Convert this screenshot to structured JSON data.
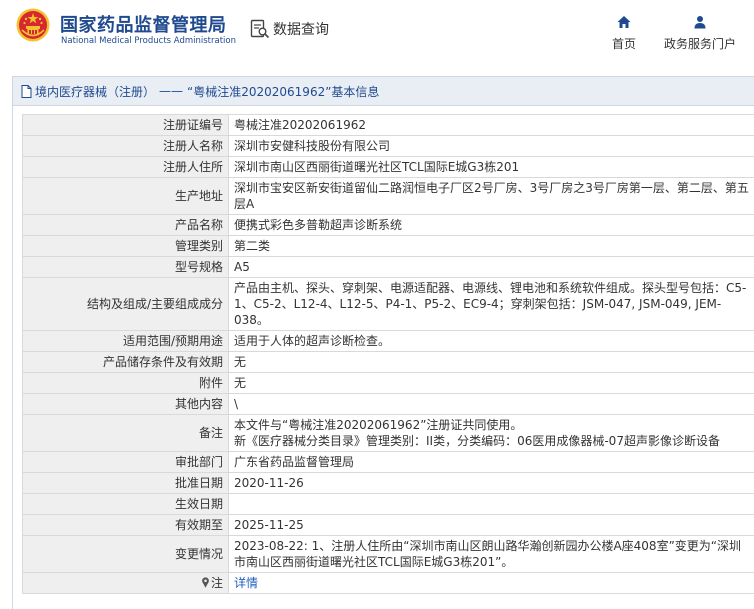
{
  "header": {
    "org_name_cn": "国家药品监督管理局",
    "org_name_en": "National Medical Products Administration",
    "query_label": "数据查询",
    "nav": [
      {
        "label": "首页",
        "icon": "home-icon"
      },
      {
        "label": "政务服务门户",
        "icon": "user-icon"
      }
    ]
  },
  "breadcrumb": {
    "category": "境内医疗器械（注册）",
    "separator": "——",
    "title": "“粤械注准20202061962”基本信息"
  },
  "fields": [
    {
      "label": "注册证编号",
      "value": "粤械注准20202061962"
    },
    {
      "label": "注册人名称",
      "value": "深圳市安健科技股份有限公司"
    },
    {
      "label": "注册人住所",
      "value": "深圳市南山区西丽街道曙光社区TCL国际E城G3栋201"
    },
    {
      "label": "生产地址",
      "value": "深圳市宝安区新安街道留仙二路润恒电子厂区2号厂房、3号厂房之3号厂房第一层、第二层、第五层A"
    },
    {
      "label": "产品名称",
      "value": "便携式彩色多普勒超声诊断系统"
    },
    {
      "label": "管理类别",
      "value": "第二类"
    },
    {
      "label": "型号规格",
      "value": "A5"
    },
    {
      "label": "结构及组成/主要组成成分",
      "value": "产品由主机、探头、穿刺架、电源适配器、电源线、锂电池和系统软件组成。探头型号包括：C5-1、C5-2、L12-4、L12-5、P4-1、P5-2、EC9-4；穿刺架包括：JSM-047, JSM-049, JEM-038。"
    },
    {
      "label": "适用范围/预期用途",
      "value": "适用于人体的超声诊断检查。"
    },
    {
      "label": "产品储存条件及有效期",
      "value": "无"
    },
    {
      "label": "附件",
      "value": "无"
    },
    {
      "label": "其他内容",
      "value": "\\"
    },
    {
      "label": "备注",
      "value_line1": "本文件与“粤械注准20202061962”注册证共同使用。",
      "value_line2": "新《医疗器械分类目录》管理类别：II类，分类编码：06医用成像器械-07超声影像诊断设备"
    },
    {
      "label": "审批部门",
      "value": "广东省药品监督管理局"
    },
    {
      "label": "批准日期",
      "value": "2020-11-26"
    },
    {
      "label": "生效日期",
      "value": ""
    },
    {
      "label": "有效期至",
      "value": "2025-11-25"
    },
    {
      "label": "变更情况",
      "value": "2023-08-22: 1、注册人住所由“深圳市南山区朗山路华瀚创新园办公楼A座408室”变更为“深圳市南山区西丽街道曙光社区TCL国际E城G3栋201”。"
    },
    {
      "label": "注",
      "value": "详情",
      "icon": "pin-icon"
    }
  ],
  "colors": {
    "brand_blue": "#1f4a8f",
    "emblem_red": "#d8282f",
    "emblem_gold": "#f2c230",
    "label_bg": "#efefef",
    "breadcrumb_bg": "#e9eef5",
    "link": "#1f5fbf"
  }
}
